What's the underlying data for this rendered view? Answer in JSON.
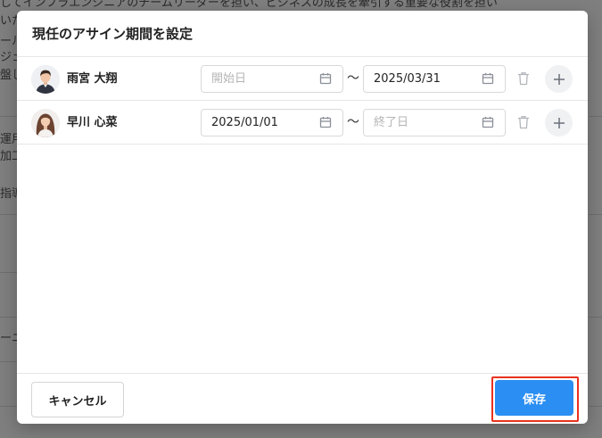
{
  "background": {
    "lines": [
      "してインフラエンジニアのチームリーダーを担い、ビジネスの成長を牽引する重要な役割を担い",
      "いた",
      "ール",
      "ジェ",
      "盤し",
      "運用",
      "加工",
      "指導",
      "ーニ"
    ]
  },
  "modal": {
    "title": "現任のアサイン期間を設定",
    "rows": [
      {
        "name": "雨宮 大翔",
        "start_value": "",
        "start_placeholder": "開始日",
        "end_value": "2025/03/31",
        "end_placeholder": "終了日",
        "separator": "〜"
      },
      {
        "name": "早川 心菜",
        "start_value": "2025/01/01",
        "start_placeholder": "開始日",
        "end_value": "",
        "end_placeholder": "終了日",
        "separator": "〜"
      }
    ],
    "cancel_label": "キャンセル",
    "save_label": "保存"
  },
  "colors": {
    "accent": "#2b8ef2",
    "highlight": "#e8321f"
  },
  "icons": {
    "calendar": "calendar-icon",
    "trash": "trash-icon",
    "plus": "plus-icon"
  }
}
